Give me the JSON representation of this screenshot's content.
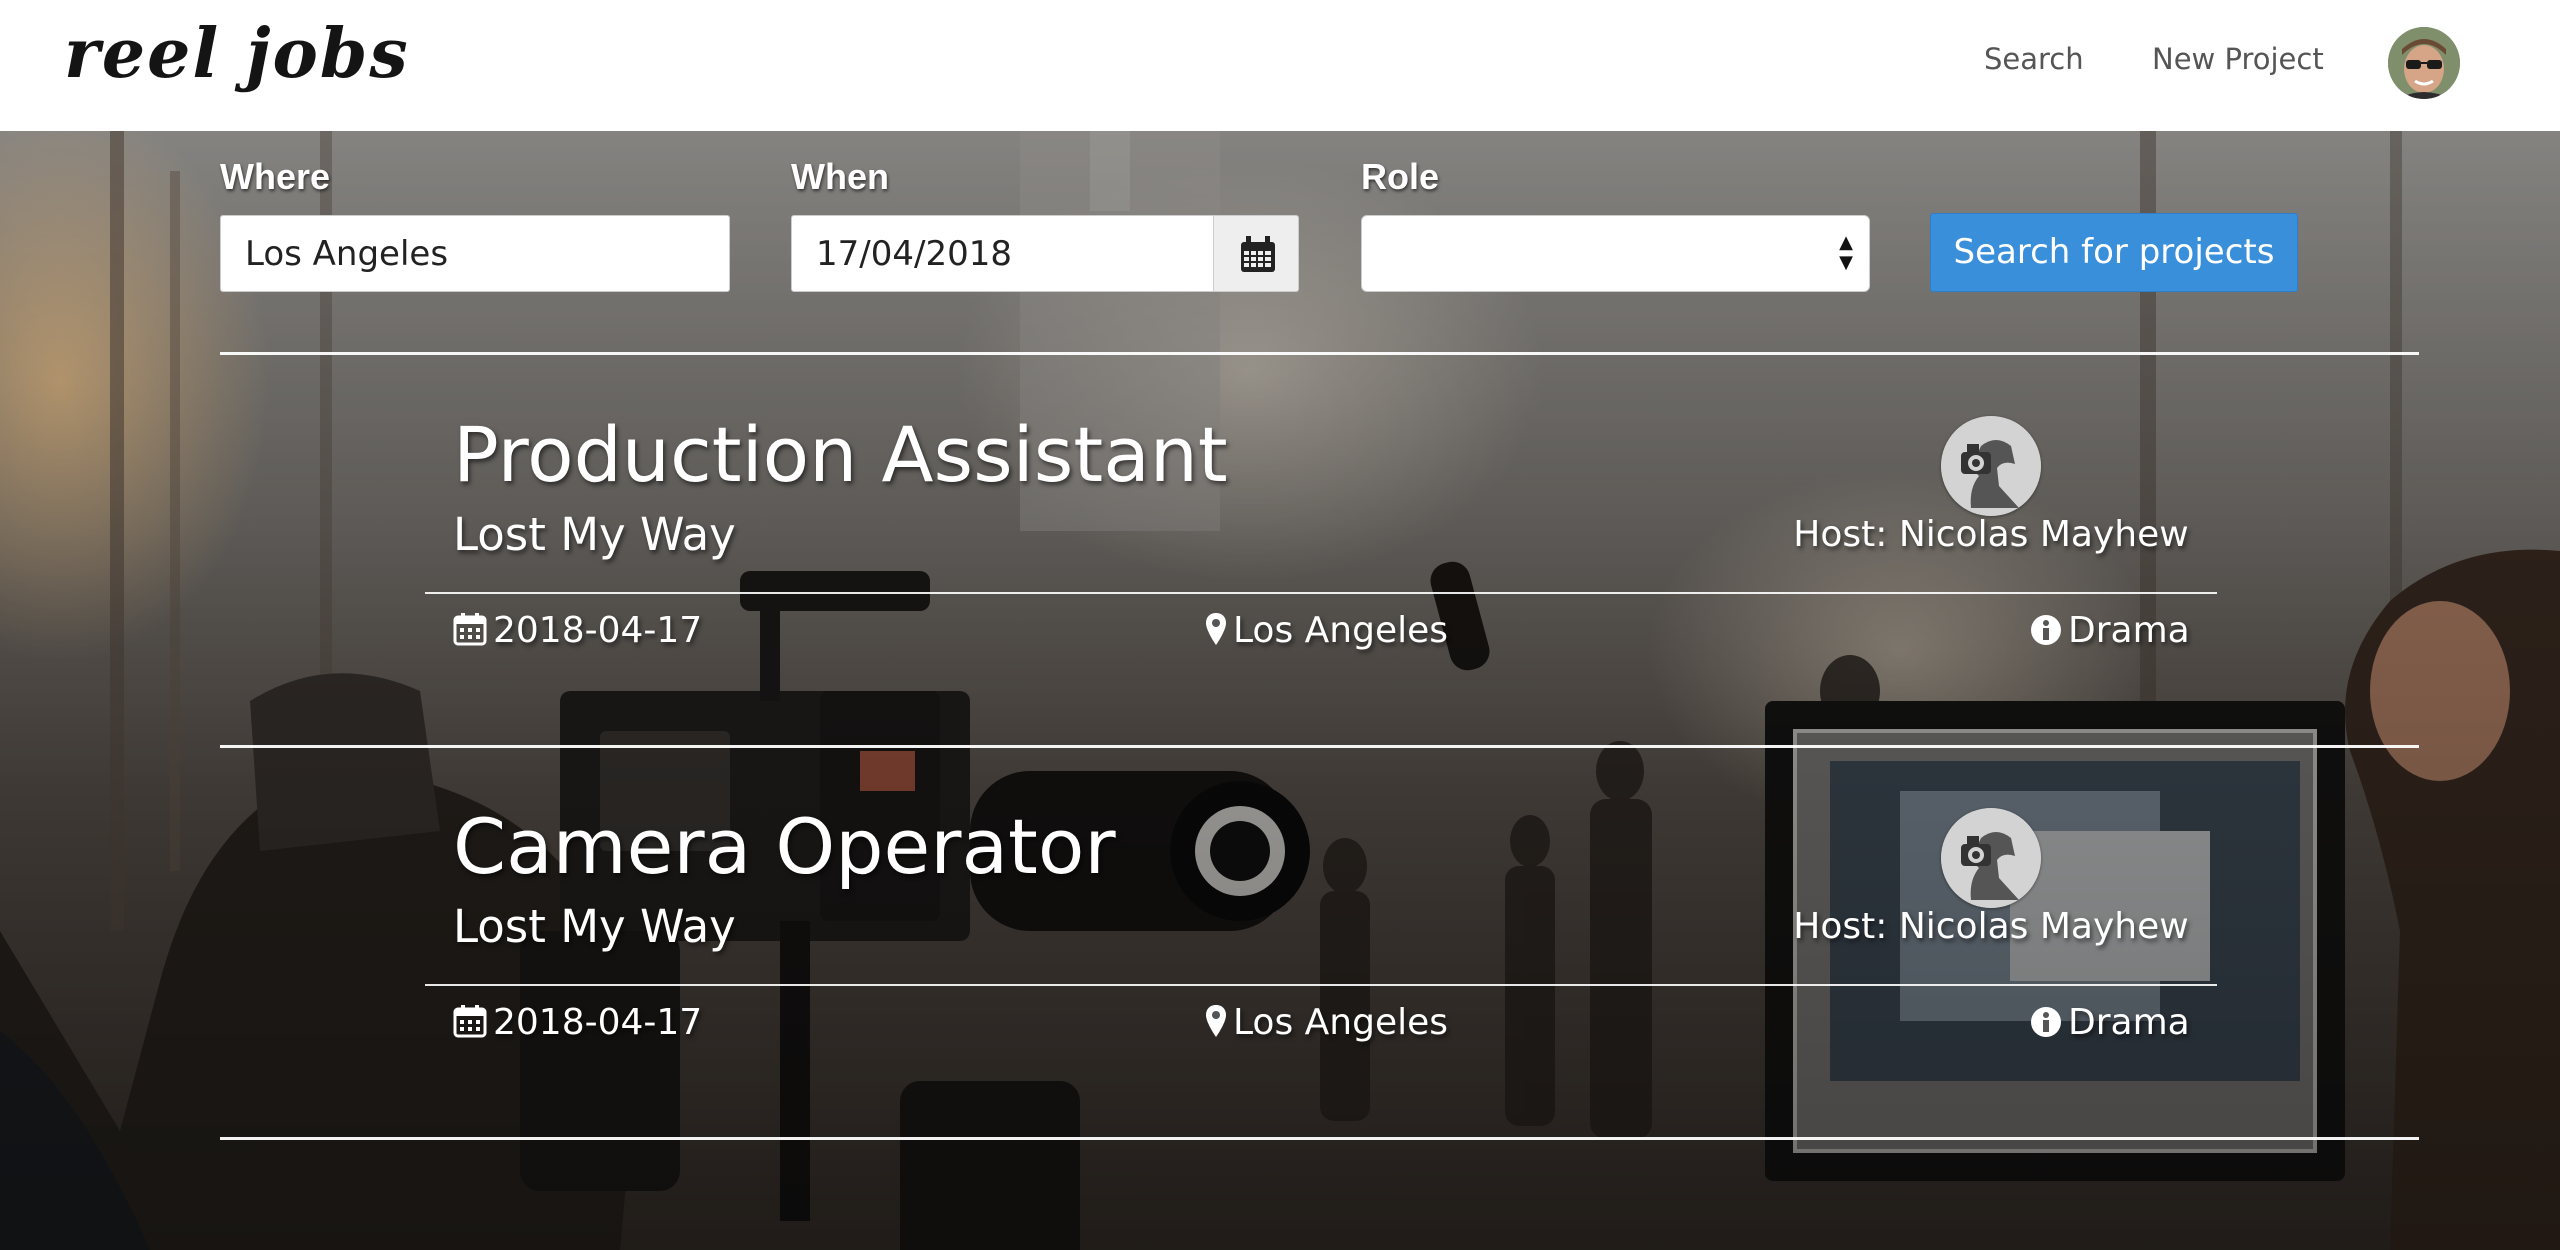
{
  "navbar": {
    "logo": "reel jobs",
    "links": [
      "Search",
      "New Project"
    ]
  },
  "search_form": {
    "where": {
      "label": "Where",
      "value": "Los Angeles"
    },
    "when": {
      "label": "When",
      "value": "17/04/2018"
    },
    "role": {
      "label": "Role",
      "value": ""
    },
    "submit_label": "Search for projects"
  },
  "results": [
    {
      "title": "Production Assistant",
      "project": "Lost My Way",
      "host": "Host: Nicolas Mayhew",
      "date": "2018-04-17",
      "location": "Los Angeles",
      "genre": "Drama"
    },
    {
      "title": "Camera Operator",
      "project": "Lost My Way",
      "host": "Host: Nicolas Mayhew",
      "date": "2018-04-17",
      "location": "Los Angeles",
      "genre": "Drama"
    }
  ],
  "icons": {
    "date": "calendar-icon",
    "location": "map-marker-icon",
    "genre": "info-circle-icon",
    "date_picker": "calendar-icon",
    "select": "select-arrows-icon"
  },
  "colors": {
    "primary_button": "#3a8fdb",
    "navbar_bg": "#ffffff",
    "nav_link": "#555555"
  }
}
